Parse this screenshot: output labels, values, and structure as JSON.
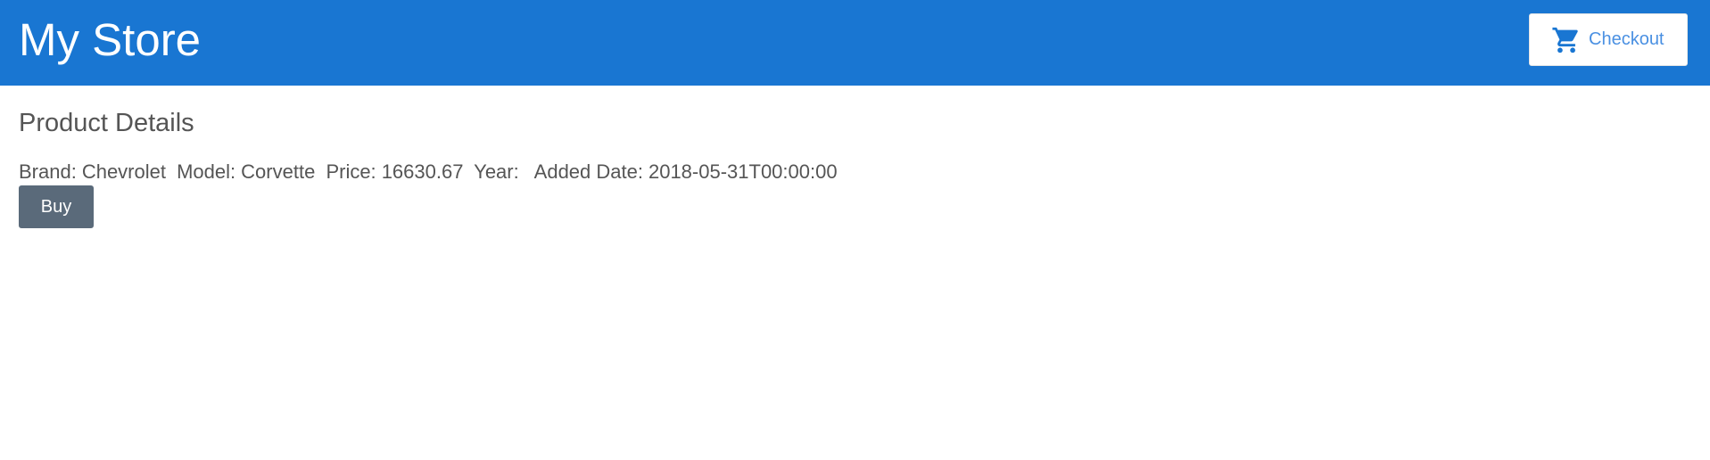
{
  "header": {
    "title": "My Store",
    "checkout_label": "Checkout",
    "checkout_icon": "shopping-cart-icon",
    "background_color": "#1976d2",
    "accent_color": "#4a90e2"
  },
  "main": {
    "section_title": "Product Details",
    "product": {
      "brand_label": "Brand:",
      "brand_value": "Chevrolet",
      "model_label": "Model:",
      "model_value": "Corvette",
      "price_label": "Price:",
      "price_value": "16630.67",
      "year_label": "Year:",
      "year_value": "",
      "added_date_label": "Added Date:",
      "added_date_value": "2018-05-31T00:00:00"
    },
    "buy_label": "Buy",
    "buy_color": "#5a6a7a"
  }
}
